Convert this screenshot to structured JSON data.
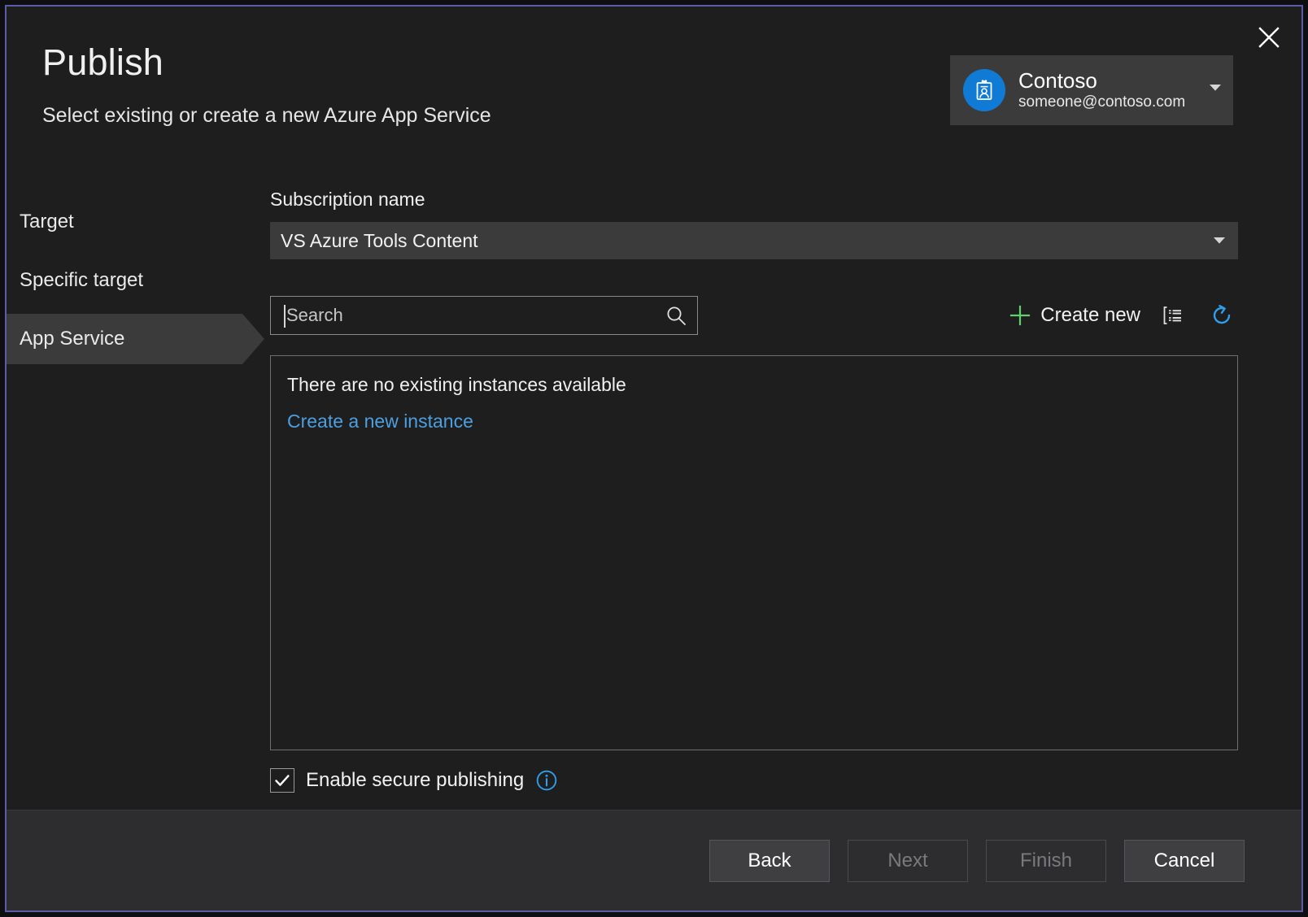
{
  "window": {
    "close_icon": "close-icon",
    "accent_border": "#5c5ca8",
    "background": "#1e1e1e"
  },
  "header": {
    "title": "Publish",
    "subtitle": "Select existing or create a new Azure App Service"
  },
  "account": {
    "name": "Contoso",
    "email": "someone@contoso.com",
    "avatar_icon": "id-badge-icon",
    "caret_icon": "chevron-down-icon",
    "avatar_color": "#0f7bd4"
  },
  "sidebar": {
    "items": [
      {
        "label": "Target",
        "selected": false
      },
      {
        "label": "Specific target",
        "selected": false
      },
      {
        "label": "App Service",
        "selected": true
      }
    ]
  },
  "main": {
    "subscription": {
      "label": "Subscription name",
      "value": "VS Azure Tools Content",
      "caret_icon": "chevron-down-icon"
    },
    "search": {
      "placeholder": "Search",
      "value": "",
      "icon": "search-icon"
    },
    "toolbar": {
      "create_new_label": "Create new",
      "create_new_icon": "plus-icon",
      "group_icon": "group-list-icon",
      "refresh_icon": "refresh-icon",
      "plus_color": "#5fd26a",
      "refresh_color": "#2e9fe8"
    },
    "instances": {
      "empty_message": "There are no existing instances available",
      "create_link": "Create a new instance",
      "link_color": "#4c9fe0"
    },
    "secure_publishing": {
      "label": "Enable secure publishing",
      "checked": true,
      "check_icon": "checkmark-icon",
      "info_icon": "info-icon",
      "info_color": "#2e9fe8"
    }
  },
  "footer": {
    "buttons": [
      {
        "label": "Back",
        "enabled": true
      },
      {
        "label": "Next",
        "enabled": false
      },
      {
        "label": "Finish",
        "enabled": false
      },
      {
        "label": "Cancel",
        "enabled": true
      }
    ]
  }
}
